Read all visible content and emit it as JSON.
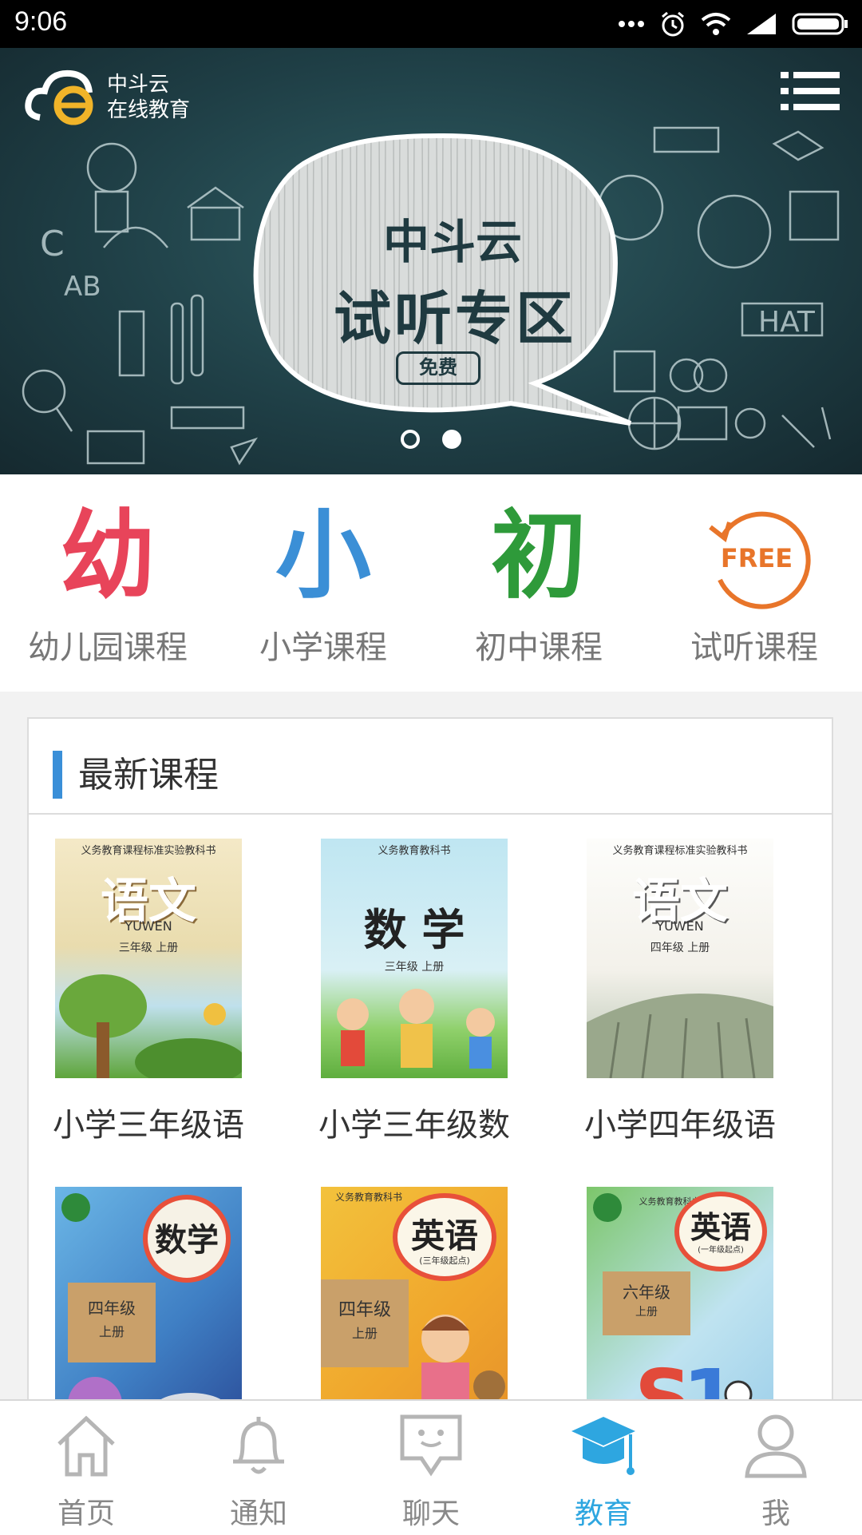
{
  "status_bar": {
    "time": "9:06"
  },
  "banner": {
    "logo_line1": "中斗云",
    "logo_line2": "在线教育",
    "brand": "中斗云",
    "title": "试听专区",
    "tag": "免费"
  },
  "categories": [
    {
      "glyph": "幼",
      "label": "幼儿园课程",
      "color": "#e8445a"
    },
    {
      "glyph": "小",
      "label": "小学课程",
      "color": "#3b8fd6"
    },
    {
      "glyph": "初",
      "label": "初中课程",
      "color": "#2e9a3a"
    },
    {
      "glyph": "FREE",
      "label": "试听课程",
      "color": "#e8752a"
    }
  ],
  "latest": {
    "title": "最新课程",
    "courses": [
      {
        "name": "小学三年级语",
        "cover_text": "语文",
        "cover_sub": "YUWEN",
        "grade": "三年级 上册",
        "header": "义务教育课程标准实验教科书"
      },
      {
        "name": "小学三年级数",
        "cover_text": "数 学",
        "cover_sub": "",
        "grade": "三年级 上册",
        "header": "义务教育教科书"
      },
      {
        "name": "小学四年级语",
        "cover_text": "语文",
        "cover_sub": "YUWEN",
        "grade": "四年级 上册",
        "header": "义务教育课程标准实验教科书"
      },
      {
        "name": "",
        "cover_text": "数学",
        "cover_sub": "",
        "grade": "四年级",
        "grade2": "上册",
        "header": ""
      },
      {
        "name": "",
        "cover_text": "英语",
        "cover_sub": "(三年级起点)",
        "grade": "四年级",
        "grade2": "上册",
        "header": "义务教育教科书"
      },
      {
        "name": "",
        "cover_text": "英语",
        "cover_sub": "(一年级起点)",
        "grade": "六年级",
        "grade2": "上册",
        "header": "义务教育教科书"
      }
    ]
  },
  "tabs": [
    {
      "label": "首页",
      "icon": "home-icon"
    },
    {
      "label": "通知",
      "icon": "bell-icon"
    },
    {
      "label": "聊天",
      "icon": "chat-icon"
    },
    {
      "label": "教育",
      "icon": "graduation-cap-icon",
      "active": true
    },
    {
      "label": "我",
      "icon": "user-icon"
    }
  ],
  "colors": {
    "accent": "#2ea6e0",
    "section_bar": "#3a8fd8"
  }
}
